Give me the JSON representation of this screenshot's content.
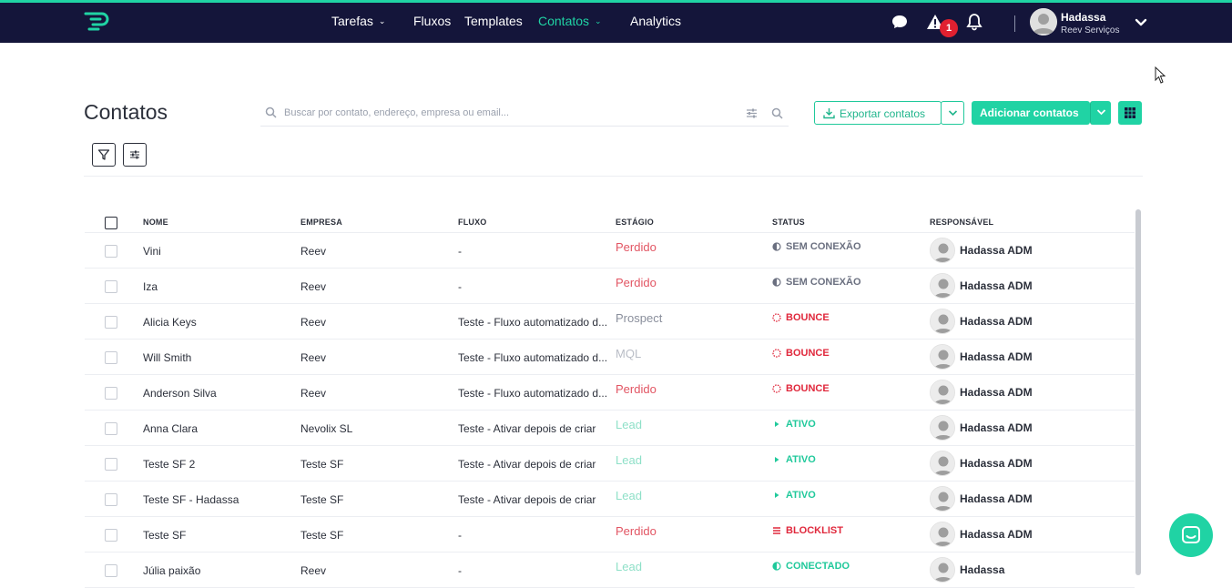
{
  "header": {
    "nav": [
      {
        "label": "Tarefas",
        "dropdown": true,
        "active": false
      },
      {
        "label": "Fluxos",
        "dropdown": false,
        "active": false
      },
      {
        "label": "Templates",
        "dropdown": false,
        "active": false
      },
      {
        "label": "Contatos",
        "dropdown": true,
        "active": true
      },
      {
        "label": "Analytics",
        "dropdown": false,
        "active": false
      }
    ],
    "alert_count": "1",
    "user": {
      "name": "Hadassa",
      "company": "Reev Serviços"
    },
    "icons": [
      "logo-icon",
      "chat-icon",
      "alert-icon",
      "bell-icon",
      "user-avatar",
      "chevron-down-icon"
    ]
  },
  "page": {
    "title": "Contatos",
    "search_placeholder": "Buscar por contato, endereço, empresa ou email...",
    "export_label": "Exportar contatos",
    "add_label": "Adicionar contatos"
  },
  "table": {
    "headers": {
      "name": "NOME",
      "company": "EMPRESA",
      "flow": "FLUXO",
      "stage": "ESTÁGIO",
      "status": "STATUS",
      "owner": "RESPONSÁVEL"
    },
    "rows": [
      {
        "name": "Vini",
        "company": "Reev",
        "flow": "-",
        "stage": "Perdido",
        "status": "SEM CONEXÃO",
        "owner": "Hadassa ADM"
      },
      {
        "name": "Iza",
        "company": "Reev",
        "flow": "-",
        "stage": "Perdido",
        "status": "SEM CONEXÃO",
        "owner": "Hadassa ADM"
      },
      {
        "name": "Alicia Keys",
        "company": "Reev",
        "flow": "Teste - Fluxo automatizado d...",
        "stage": "Prospect",
        "status": "BOUNCE",
        "owner": "Hadassa ADM"
      },
      {
        "name": "Will Smith",
        "company": "Reev",
        "flow": "Teste - Fluxo automatizado d...",
        "stage": "MQL",
        "status": "BOUNCE",
        "owner": "Hadassa ADM"
      },
      {
        "name": "Anderson Silva",
        "company": "Reev",
        "flow": "Teste - Fluxo automatizado d...",
        "stage": "Perdido",
        "status": "BOUNCE",
        "owner": "Hadassa ADM"
      },
      {
        "name": "Anna Clara",
        "company": "Nevolix SL",
        "flow": "Teste - Ativar depois de criar",
        "stage": "Lead",
        "status": "ATIVO",
        "owner": "Hadassa ADM"
      },
      {
        "name": "Teste SF 2",
        "company": "Teste SF",
        "flow": "Teste - Ativar depois de criar",
        "stage": "Lead",
        "status": "ATIVO",
        "owner": "Hadassa ADM"
      },
      {
        "name": "Teste SF - Hadassa",
        "company": "Teste SF",
        "flow": "Teste - Ativar depois de criar",
        "stage": "Lead",
        "status": "ATIVO",
        "owner": "Hadassa ADM"
      },
      {
        "name": "Teste SF",
        "company": "Teste SF",
        "flow": "-",
        "stage": "Perdido",
        "status": "BLOCKLIST",
        "owner": "Hadassa ADM"
      },
      {
        "name": "Júlia paixão",
        "company": "Reev",
        "flow": "-",
        "stage": "Lead",
        "status": "CONECTADO",
        "owner": "Hadassa"
      }
    ]
  },
  "colors": {
    "topbar": "#14153a",
    "accent": "#20d3a4",
    "stage_perdido": "#e25563",
    "stage_prospect": "#8a8f9c",
    "stage_mql": "#b9bdc6",
    "stage_lead": "#8fe0c8",
    "status_sem_conexao": "#6b7080",
    "status_bounce": "#e0283c",
    "status_ativo": "#20c99b",
    "status_blocklist": "#e0283c",
    "status_conectado": "#20c99b"
  }
}
